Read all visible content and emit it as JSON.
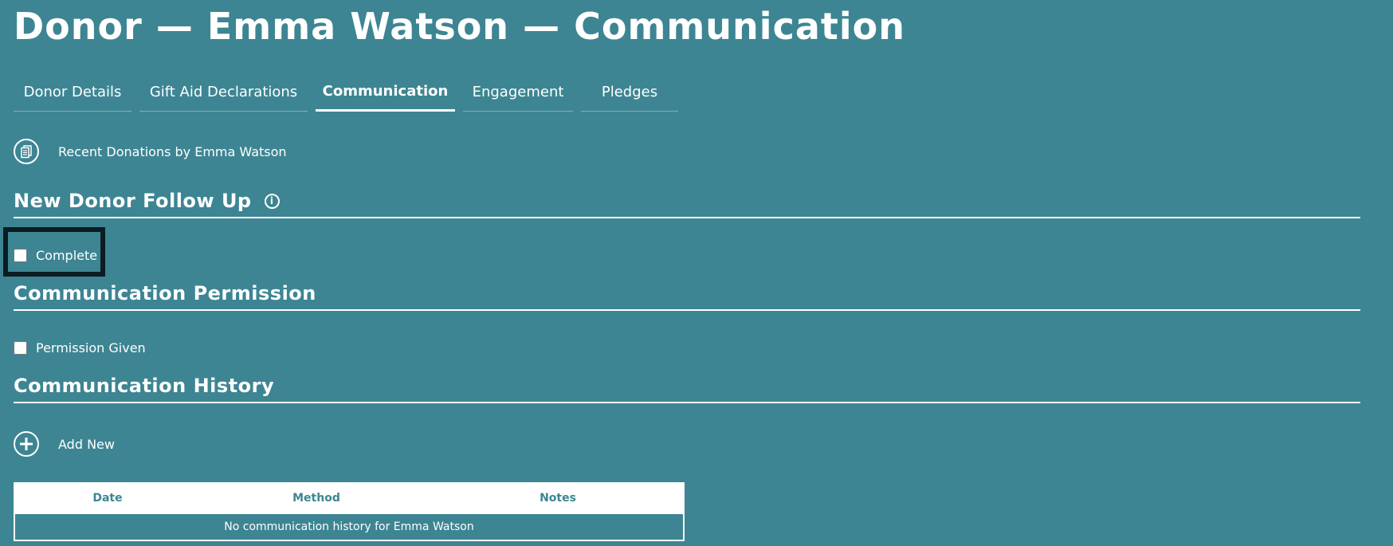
{
  "page": {
    "title": "Donor — Emma Watson — Communication"
  },
  "tabs": [
    {
      "label": "Donor Details",
      "active": false
    },
    {
      "label": "Gift Aid Declarations",
      "active": false
    },
    {
      "label": "Communication",
      "active": true
    },
    {
      "label": "Engagement",
      "active": false
    },
    {
      "label": "Pledges",
      "active": false
    }
  ],
  "recent_donations": {
    "icon": "document-list-icon",
    "label": "Recent Donations by Emma Watson"
  },
  "follow_up": {
    "title": "New Donor Follow Up",
    "info_icon": "info-icon",
    "info_glyph": "i",
    "complete_label": "Complete",
    "complete_checked": false
  },
  "permission": {
    "title": "Communication Permission",
    "permission_label": "Permission Given",
    "permission_checked": false
  },
  "history": {
    "title": "Communication History",
    "add_icon": "plus-circle-icon",
    "add_label": "Add New",
    "columns": [
      "Date",
      "Method",
      "Notes"
    ],
    "empty_message": "No communication history for Emma Watson"
  },
  "colors": {
    "background": "#3d8593",
    "foreground": "#ffffff",
    "highlight_border": "#0b1d22"
  }
}
